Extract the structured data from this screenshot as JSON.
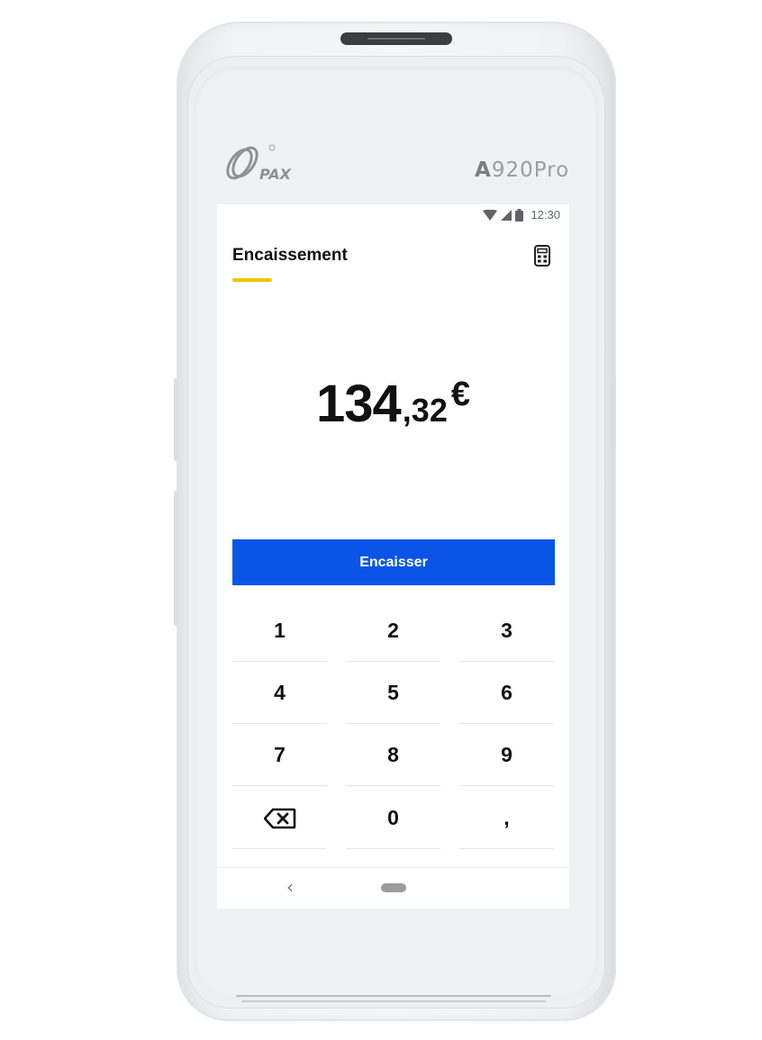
{
  "device": {
    "brand_label": "PAX",
    "model_label": "A920Pro",
    "model_prefix": "A",
    "model_suffix": "920Pro"
  },
  "status_bar": {
    "time": "12:30",
    "icons": [
      "wifi-icon",
      "signal-icon",
      "battery-icon"
    ]
  },
  "header": {
    "title": "Encaissement",
    "accent_color": "#f5c400",
    "action_icon": "calculator-icon"
  },
  "amount": {
    "integer_part": "134",
    "separator": ",",
    "decimal_part": "32",
    "currency": "€"
  },
  "charge_button": {
    "label": "Encaisser",
    "color": "#0a55e8"
  },
  "keypad": {
    "keys": [
      "1",
      "2",
      "3",
      "4",
      "5",
      "6",
      "7",
      "8",
      "9",
      "",
      "0",
      ","
    ],
    "backspace_icon": "backspace-icon"
  },
  "nav_bar": {
    "back_icon": "chevron-left-icon",
    "home_icon": "home-pill-icon"
  }
}
